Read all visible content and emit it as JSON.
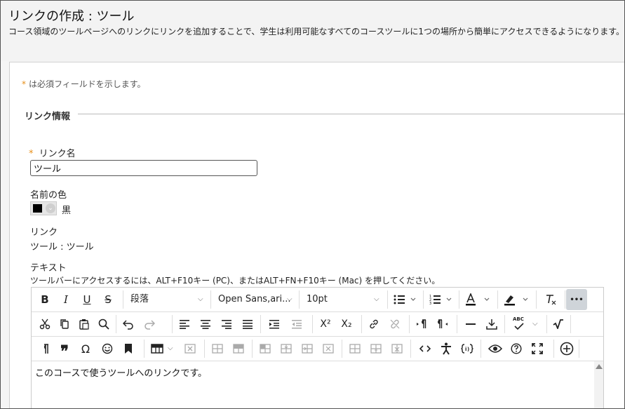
{
  "header": {
    "title": "リンクの作成 : ツール",
    "description": "コース領域のツールページへのリンクにリンクを追加することで、学生は利用可能なすべてのコースツールに1つの場所から簡単にアクセスできるようになります。"
  },
  "required_note": {
    "marker": "*",
    "text": "は必須フィールドを示します。"
  },
  "section": {
    "title": "リンク情報"
  },
  "link_name": {
    "marker": "*",
    "label": "リンク名",
    "value": "ツール"
  },
  "name_color": {
    "label": "名前の色",
    "value": "黒",
    "color": "#000000"
  },
  "link": {
    "label": "リンク",
    "value": "ツール : ツール"
  },
  "text_field": {
    "label": "テキスト",
    "hint": "ツールバーにアクセスするには、ALT+F10キー (PC)、またはALT+FN+F10キー (Mac) を押してください。"
  },
  "toolbar": {
    "bold": "B",
    "italic": "I",
    "underline": "U",
    "strike": "S",
    "paragraph": "段落",
    "font": "Open Sans,ari...",
    "size": "10pt",
    "superscript": "X²",
    "subscript": "X₂",
    "quote": "❞",
    "omega": "Ω",
    "more": "•••",
    "spell": "ABC"
  },
  "editor": {
    "content": "このコースで使うツールへのリンクです。"
  }
}
